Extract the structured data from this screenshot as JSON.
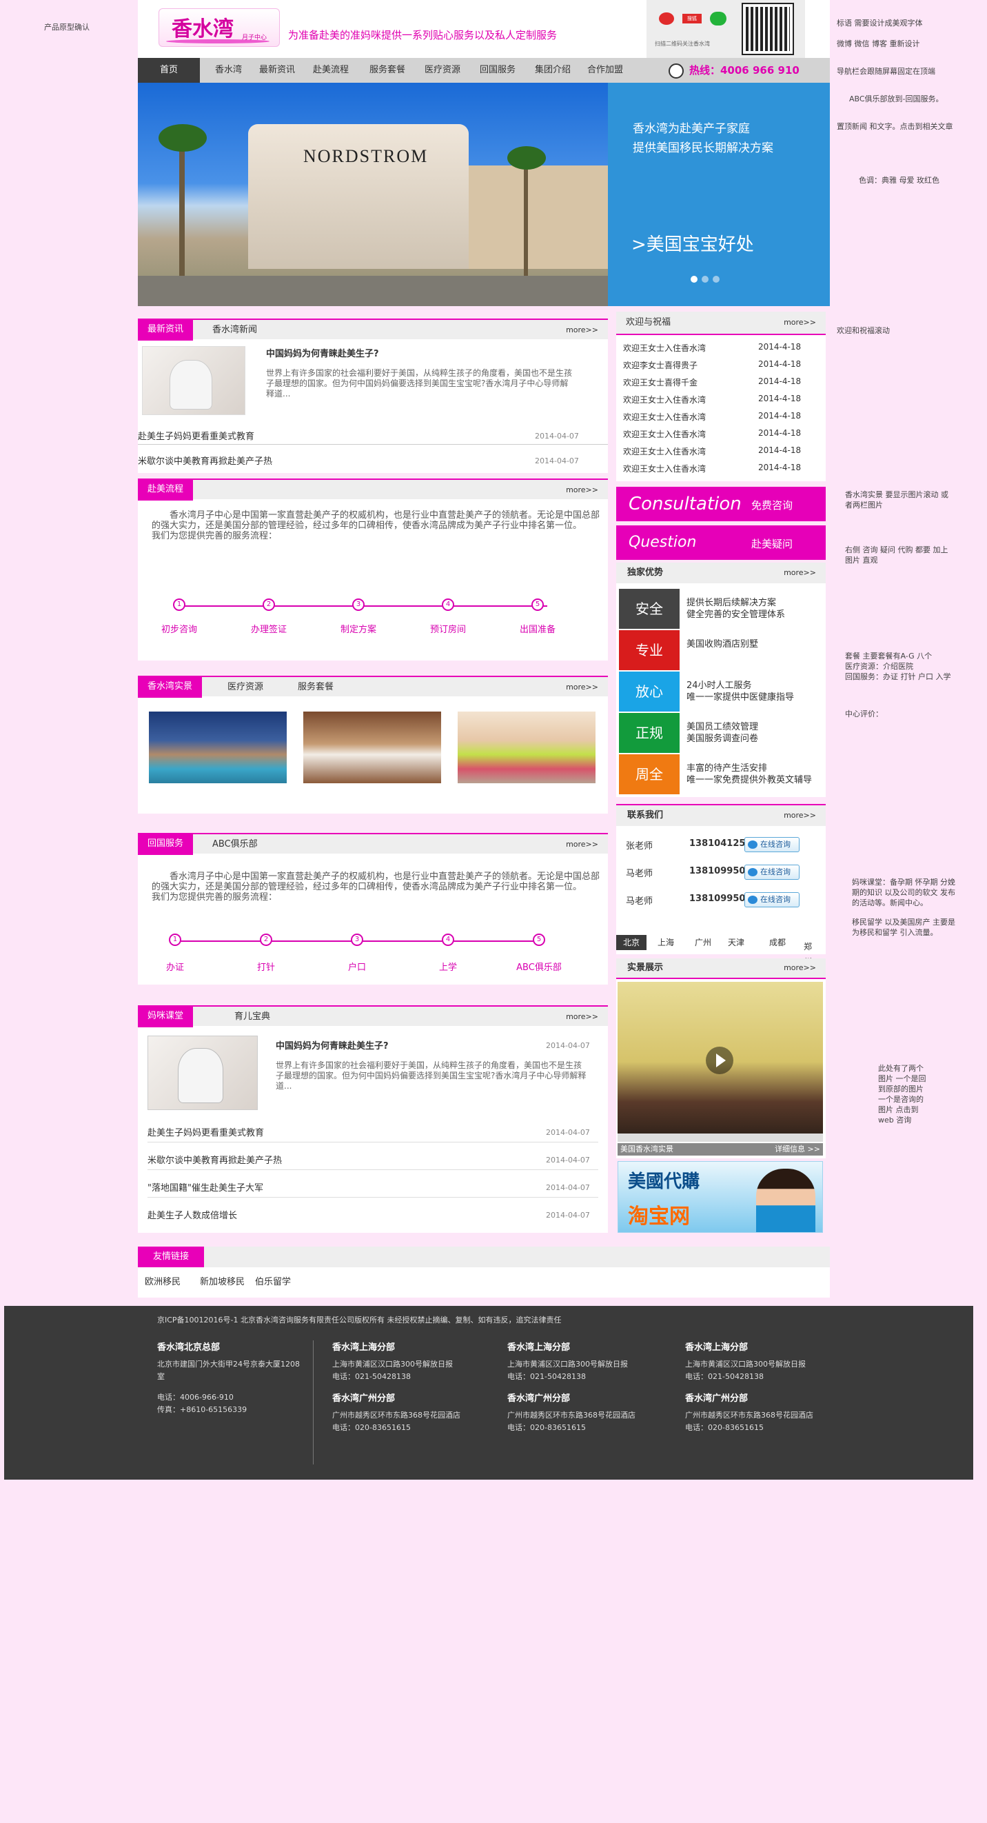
{
  "notes": {
    "left_top": "产品原型确认",
    "r1": "标语 需要设计成美观字体",
    "r2": "微博 微信 博客 重新设计",
    "r3": "导航栏会跟随屏幕固定在顶端",
    "r4": "ABC俱乐部放到-回国服务。",
    "r5": "置顶新闻 和文字。点击到相关文章",
    "r6": "色调：典雅 母爱 玫红色",
    "r7": "欢迎和祝福滚动",
    "r8": "香水湾实景 要显示图片滚动 或者两栏图片",
    "r9": "右侧 咨询 疑问 代购 都要 加上图片 直观",
    "r10": "套餐 主要套餐有A-G 八个\n医疗资源：介绍医院\n回国服务：办证 打针 户口 入学",
    "r11": "中心评价：",
    "r12": "妈咪课堂：备孕期 怀孕期 分娩期的知识 以及公司的软文 发布的活动等。新闻中心。",
    "r13": "移民留学 以及美国房产 主要是为移民和留学 引入流量。",
    "r14": "此处有了两个图片 一个是回到原部的图片 一个是咨询的图片 点击到web 咨询"
  },
  "header": {
    "logo_text": "香水湾",
    "logo_sub": "月子中心",
    "slogan": "为准备赴美的准妈咪提供一系列贴心服务以及私人定制服务",
    "social_sina": "新浪微博",
    "social_sohu": "搜狐",
    "social_scan": "扫描二维码关注香水湾",
    "hotline": "热线：4006 966 910"
  },
  "nav": [
    "首页",
    "香水湾",
    "最新资讯",
    "赴美流程",
    "服务套餐",
    "医疗资源",
    "回国服务",
    "集团介绍",
    "合作加盟"
  ],
  "banner": {
    "store_sign": "NORDSTROM",
    "line1": "香水湾为赴美产子家庭",
    "line2": "提供美国移民长期解决方案",
    "big": ">美国宝宝好处"
  },
  "news": {
    "tag": "最新资讯",
    "tab2": "香水湾新闻",
    "more": "more>>",
    "top_title": "中国妈妈为何青睐赴美生子?",
    "top_body": "世界上有许多国家的社会福利要好于美国，从纯粹生孩子的角度看，美国也不是生孩子最理想的国家。但为何中国妈妈偏要选择到美国生宝宝呢?香水湾月子中心导师解释道...",
    "items": [
      {
        "title": "赴美生子妈妈更看重美式教育",
        "date": "2014-04-07"
      },
      {
        "title": "米歇尔谈中美教育再掀赴美产子热",
        "date": "2014-04-07"
      }
    ]
  },
  "welcome": {
    "title": "欢迎与祝福",
    "more": "more>>",
    "items": [
      {
        "t": "欢迎王女士入住香水湾",
        "d": "2014-4-18"
      },
      {
        "t": "欢迎李女士喜得贵子",
        "d": "2014-4-18"
      },
      {
        "t": "欢迎王女士喜得千金",
        "d": "2014-4-18"
      },
      {
        "t": "欢迎王女士入住香水湾",
        "d": "2014-4-18"
      },
      {
        "t": "欢迎王女士入住香水湾",
        "d": "2014-4-18"
      },
      {
        "t": "欢迎王女士入住香水湾",
        "d": "2014-4-18"
      },
      {
        "t": "欢迎王女士入住香水湾",
        "d": "2014-4-18"
      },
      {
        "t": "欢迎王女士入住香水湾",
        "d": "2014-4-18"
      }
    ]
  },
  "flow": {
    "tag": "赴美流程",
    "more": "more>>",
    "body": "香水湾月子中心是中国第一家直营赴美产子的权威机构，也是行业中直营赴美产子的领航者。无论是中国总部的强大实力，还是美国分部的管理经验，经过多年的口碑相传，使香水湾品牌成为美产子行业中排名第一位。\n        我们为您提供完善的服务流程：",
    "steps": [
      "初步咨询",
      "办理签证",
      "制定方案",
      "预订房间",
      "出国准备"
    ]
  },
  "consult": {
    "c_big": "Consultation",
    "c_small": "免费咨询",
    "q_big": "Question",
    "q_small": "赴美疑问"
  },
  "advantages": {
    "title": "独家优势",
    "more": "more>>",
    "items": [
      {
        "label": "安全",
        "color": "#444444",
        "t": "提供长期后续解决方案\n健全完善的安全管理体系"
      },
      {
        "label": "专业",
        "color": "#d81c1c",
        "t": "美国收购酒店别墅"
      },
      {
        "label": "放心",
        "color": "#1aa4e6",
        "t": "24小时人工服务\n唯一一家提供中医健康指导"
      },
      {
        "label": "正规",
        "color": "#129b3c",
        "t": "美国员工绩效管理\n美国服务调查问卷"
      },
      {
        "label": "周全",
        "color": "#f07a12",
        "t": "丰富的待产生活安排\n唯一一家免费提供外教英文辅导"
      }
    ]
  },
  "scenes": {
    "tag": "香水湾实景",
    "tab2": "医疗资源",
    "tab3": "服务套餐",
    "more": "more>>"
  },
  "contact": {
    "title": "联系我们",
    "more": "more>>",
    "items": [
      {
        "name": "张老师",
        "phone": "13810412547",
        "btn": "在线咨询"
      },
      {
        "name": "马老师",
        "phone": "13810995084",
        "btn": "在线咨询"
      },
      {
        "name": "马老师",
        "phone": "13810995084",
        "btn": "在线咨询"
      }
    ],
    "cities": [
      "北京",
      "上海",
      "广州",
      "天津",
      "成都",
      "郑州"
    ]
  },
  "service": {
    "tag": "回国服务",
    "tab2": "ABC俱乐部",
    "more": "more>>",
    "body": "香水湾月子中心是中国第一家直营赴美产子的权威机构，也是行业中直营赴美产子的领航者。无论是中国总部的强大实力，还是美国分部的管理经验，经过多年的口碑相传，使香水湾品牌成为美产子行业中排名第一位。\n        我们为您提供完善的服务流程：",
    "steps": [
      "办证",
      "打针",
      "户口",
      "上学",
      "ABC俱乐部"
    ]
  },
  "video": {
    "title": "实景展示",
    "more": "more>>",
    "caption": "美国香水湾实景",
    "detail": "详细信息 >>"
  },
  "taobao": {
    "line1": "美國代購",
    "line2": "淘宝网"
  },
  "class": {
    "tag": "妈咪课堂",
    "tab2": "育儿宝典",
    "more": "more>>",
    "top_title": "中国妈妈为何青睐赴美生子?",
    "top_date": "2014-04-07",
    "top_body": "世界上有许多国家的社会福利要好于美国，从纯粹生孩子的角度看，美国也不是生孩子最理想的国家。但为何中国妈妈偏要选择到美国生宝宝呢?香水湾月子中心导师解释道...",
    "items": [
      {
        "title": "赴美生子妈妈更看重美式教育",
        "date": "2014-04-07"
      },
      {
        "title": "米歇尔谈中美教育再掀赴美产子热",
        "date": "2014-04-07"
      },
      {
        "title": "\"落地国籍\"催生赴美生子大军",
        "date": "2014-04-07"
      },
      {
        "title": "赴美生子人数成倍增长",
        "date": "2014-04-07"
      }
    ]
  },
  "links": {
    "tag": "友情链接",
    "items": [
      "欧洲移民",
      "新加坡移民",
      "伯乐留学"
    ]
  },
  "footer": {
    "icp": "京ICP备10012016号-1 北京香水湾咨询服务有限责任公司版权所有 未经授权禁止摘编、复制、如有违反，追究法律责任",
    "bj_title": "香水湾北京总部",
    "bj_addr": "北京市建国门外大街甲24号京泰大厦1208室",
    "bj_tel": "电话：4006-966-910",
    "bj_fax": "传真：+8610-65156339",
    "sh_title": "香水湾上海分部",
    "sh_addr": "上海市黄浦区汉口路300号解放日报",
    "sh_tel": "电话：021-50428138",
    "gz_title": "香水湾广州分部",
    "gz_addr": "广州市越秀区环市东路368号花园酒店",
    "gz_tel": "电话：020-83651615"
  }
}
